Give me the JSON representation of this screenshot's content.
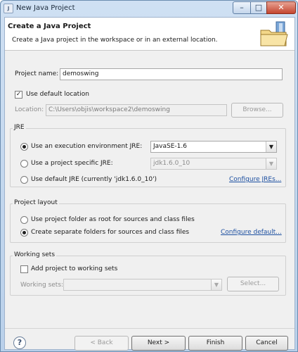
{
  "window": {
    "title": "New Java Project",
    "app_icon_text": "J",
    "min_symbol": "–",
    "max_symbol": "□",
    "close_symbol": "✕"
  },
  "header": {
    "title": "Create a Java Project",
    "description": "Create a Java project in the workspace or in an external location."
  },
  "project": {
    "name_label": "Project name:",
    "name_value": "demoswing",
    "use_default_location_label": "Use default location",
    "use_default_location_checked": true,
    "location_label": "Location:",
    "location_value": "C:\\Users\\objis\\workspace2\\demoswing",
    "browse_label": "Browse..."
  },
  "jre": {
    "legend": "JRE",
    "option_env_label": "Use an execution environment JRE:",
    "option_env_value": "JavaSE-1.6",
    "option_specific_label": "Use a project specific JRE:",
    "option_specific_value": "jdk1.6.0_10",
    "option_default_label": "Use default JRE (currently 'jdk1.6.0_10')",
    "configure_link": "Configure JREs...",
    "selected": "env"
  },
  "layout": {
    "legend": "Project layout",
    "option_root_label": "Use project folder as root for sources and class files",
    "option_separate_label": "Create separate folders for sources and class files",
    "configure_link": "Configure default...",
    "selected": "separate"
  },
  "working_sets": {
    "legend": "Working sets",
    "add_label": "Add project to working sets",
    "add_checked": false,
    "sets_label": "Working sets:",
    "sets_value": "",
    "select_label": "Select..."
  },
  "footer": {
    "help_symbol": "?",
    "back_label": "< Back",
    "next_label": "Next >",
    "finish_label": "Finish",
    "cancel_label": "Cancel"
  },
  "icons": {
    "combo_arrow": "▼",
    "check_mark": "✓"
  },
  "colors": {
    "link": "#1c4fa0",
    "dialog_bg": "#f0f0f0",
    "title_bar": "#cfe0f3"
  }
}
